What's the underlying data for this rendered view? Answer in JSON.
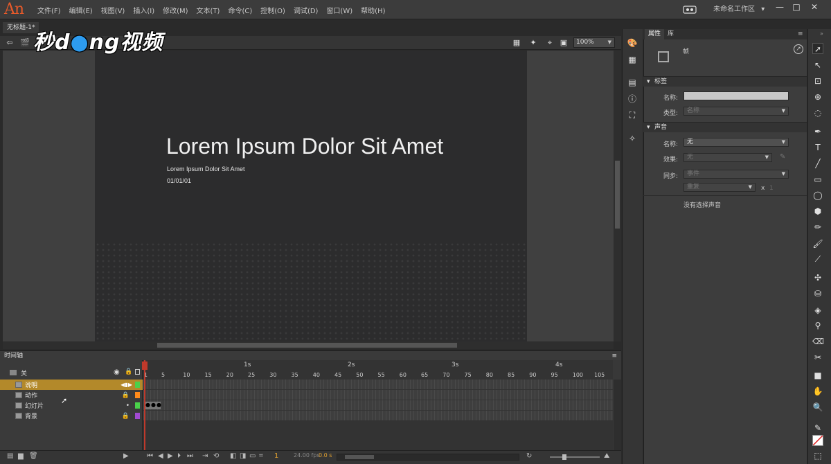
{
  "app": {
    "logo": "An"
  },
  "menus": [
    "文件(F)",
    "编辑(E)",
    "视图(V)",
    "插入(I)",
    "修改(M)",
    "文本(T)",
    "命令(C)",
    "控制(O)",
    "调试(D)",
    "窗口(W)",
    "帮助(H)"
  ],
  "workspace": {
    "label": "未命名工作区",
    "caret": "▾"
  },
  "window_buttons": {
    "minimize": "—",
    "maximize": "□",
    "close": "✕"
  },
  "document": {
    "tab": "无标题-1*"
  },
  "watermark": {
    "part1": "秒d",
    "dot": "●",
    "part2": "ng视频"
  },
  "stage_toolbar": {
    "zoom": "100%"
  },
  "stage": {
    "headline": "Lorem Ipsum Dolor Sit Amet",
    "subline": "Lorem Ipsum Dolor Sit Amet",
    "date": "01/01/01"
  },
  "timeline": {
    "title": "时间轴",
    "header_layer": "关",
    "layers": [
      {
        "name": "说明",
        "selected": true,
        "color": "#4ad14a"
      },
      {
        "name": "动作",
        "selected": false,
        "color": "#ff8a1a"
      },
      {
        "name": "幻灯片",
        "selected": false,
        "color": "#4ad14a"
      },
      {
        "name": "背景",
        "selected": false,
        "color": "#a24ad1"
      }
    ],
    "seconds": [
      "1s",
      "2s",
      "3s",
      "4s"
    ],
    "frame_numbers": [
      "1",
      "5",
      "10",
      "15",
      "20",
      "25",
      "30",
      "35",
      "40",
      "45",
      "50",
      "55",
      "60",
      "65",
      "70",
      "75",
      "80",
      "85",
      "90",
      "95",
      "100",
      "105"
    ],
    "footer": {
      "frame": "1",
      "fps": "24.00 fps",
      "time": "0.0 s"
    }
  },
  "properties": {
    "tabs": [
      "属性",
      "库"
    ],
    "type_label": "帧",
    "label_section": "标签",
    "name_label": "名称:",
    "type_field_label": "类型:",
    "type_value": "名称",
    "sound_section": "声音",
    "sound_name_label": "名称:",
    "sound_name_value": "无",
    "effect_label": "效果:",
    "effect_value": "无",
    "sync_label": "同步:",
    "sync_value": "事件",
    "repeat_value": "重复",
    "repeat_x": "x",
    "repeat_count": "1",
    "no_sound": "没有选择声音"
  }
}
